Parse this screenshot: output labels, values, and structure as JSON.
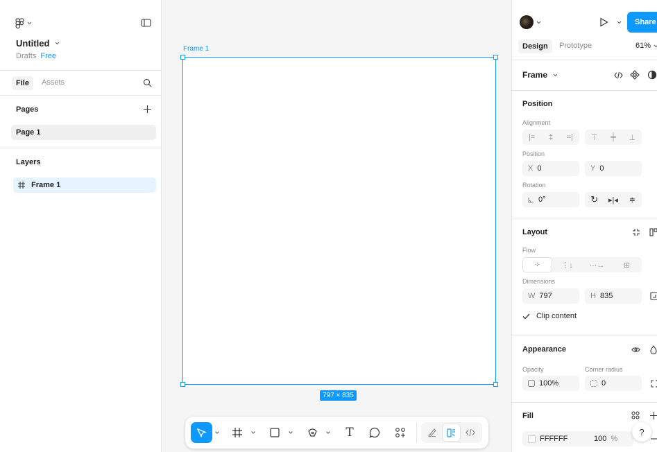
{
  "left_panel": {
    "file_name": "Untitled",
    "location": "Drafts",
    "plan": "Free",
    "tabs": [
      "File",
      "Assets"
    ],
    "pages_heading": "Pages",
    "pages": [
      "Page 1"
    ],
    "layers_heading": "Layers",
    "layers": [
      "Frame 1"
    ]
  },
  "canvas": {
    "frame_label": "Frame 1",
    "size_badge": "797 × 835"
  },
  "toolbar": {
    "tools": [
      "move",
      "frame",
      "rectangle",
      "pen",
      "text",
      "comment",
      "actions"
    ],
    "modes": [
      "draw",
      "design",
      "dev"
    ]
  },
  "right_panel": {
    "share_label": "Share",
    "tabs": [
      "Design",
      "Prototype"
    ],
    "zoom": "61%",
    "selection_type": "Frame",
    "position": {
      "heading": "Position",
      "alignment_label": "Alignment",
      "position_label": "Position",
      "x_label": "X",
      "x_value": "0",
      "y_label": "Y",
      "y_value": "0",
      "rotation_label": "Rotation",
      "rotation_value": "0°"
    },
    "layout": {
      "heading": "Layout",
      "flow_label": "Flow",
      "dimensions_label": "Dimensions",
      "w_label": "W",
      "w_value": "797",
      "h_label": "H",
      "h_value": "835",
      "clip_content": "Clip content",
      "clip_checked": true
    },
    "appearance": {
      "heading": "Appearance",
      "opacity_label": "Opacity",
      "opacity_value": "100%",
      "corner_radius_label": "Corner radius",
      "corner_radius_value": "0"
    },
    "fill": {
      "heading": "Fill",
      "hex": "FFFFFF",
      "opacity": "100",
      "unit": "%"
    },
    "help": "?"
  },
  "colors": {
    "accent": "#0d99ff",
    "canvas": "#f5f5f5",
    "selected_row": "#e5f4ff"
  }
}
